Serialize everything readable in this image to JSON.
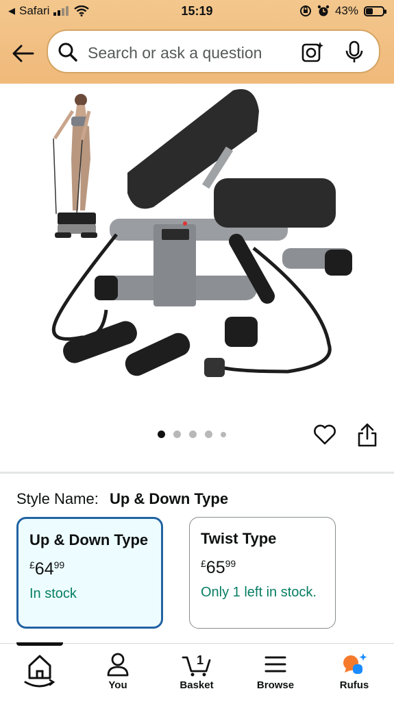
{
  "status_bar": {
    "back_app": "Safari",
    "time": "15:19",
    "battery": "43%",
    "battery_level": 0.43
  },
  "search": {
    "placeholder": "Search or ask a question"
  },
  "gallery": {
    "image_count": 5,
    "active_index": 0
  },
  "style": {
    "label": "Style Name:",
    "selected_value": "Up & Down Type"
  },
  "options": [
    {
      "name": "Up & Down Type",
      "currency": "£",
      "whole": "64",
      "fraction": "99",
      "stock": "In stock",
      "selected": true
    },
    {
      "name": "Twist Type",
      "currency": "£",
      "whole": "65",
      "fraction": "99",
      "stock": "Only 1 left in stock.",
      "selected": false
    }
  ],
  "tabbar": {
    "home": "",
    "you": "You",
    "basket": "Basket",
    "basket_count": "1",
    "browse": "Browse",
    "rufus": "Rufus"
  },
  "colors": {
    "header_bg": "#f0b97a",
    "selected_border": "#2162a1",
    "selected_bg": "#edfdff",
    "stock_green": "#067d62",
    "rufus_orange": "#f57a2c",
    "rufus_blue": "#1a8cff"
  }
}
